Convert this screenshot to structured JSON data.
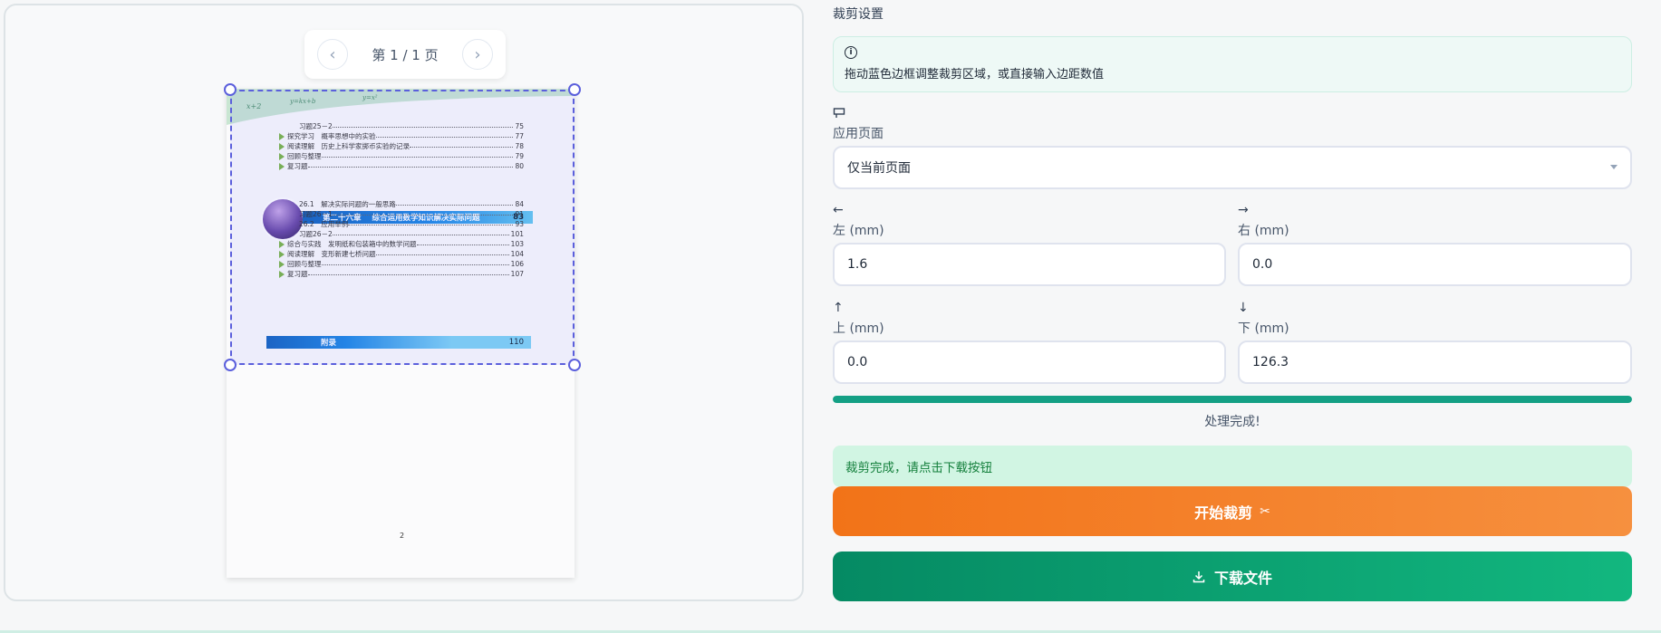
{
  "pager": {
    "prev_icon": "chevron-left-icon",
    "next_icon": "chevron-right-icon",
    "label": "第 1 / 1 页"
  },
  "preview": {
    "toc": {
      "lines": [
        {
          "text": "习题25－2",
          "page": "75",
          "bullet": false,
          "indent": true
        },
        {
          "text": "探究学习　概率思想中的实验",
          "page": "77",
          "bullet": true,
          "indent": false
        },
        {
          "text": "阅读理解　历史上科学家掷币实验的记录",
          "page": "78",
          "bullet": true,
          "indent": false
        },
        {
          "text": "回顾与整理",
          "page": "79",
          "bullet": true,
          "indent": false
        },
        {
          "text": "复习题",
          "page": "80",
          "bullet": true,
          "indent": false
        }
      ],
      "chapter": {
        "label": "第二十六章",
        "title": "综合运用数学知识解决实际问题",
        "page": "83"
      },
      "lines2": [
        {
          "text": "26.1　解决实际问题的一般思路",
          "page": "84",
          "bullet": false,
          "indent": true
        },
        {
          "text": "习题26－1",
          "page": "91",
          "bullet": false,
          "indent": true
        },
        {
          "text": "26.2　应用举例",
          "page": "93",
          "bullet": false,
          "indent": true
        },
        {
          "text": "习题26－2",
          "page": "101",
          "bullet": false,
          "indent": true
        },
        {
          "text": "综合与实践　发明纸和包装箱中的数学问题",
          "page": "103",
          "bullet": true,
          "indent": false
        },
        {
          "text": "阅读理解　变形新建七桥问题",
          "page": "104",
          "bullet": true,
          "indent": false
        },
        {
          "text": "回顾与整理",
          "page": "106",
          "bullet": true,
          "indent": false
        },
        {
          "text": "复习题",
          "page": "107",
          "bullet": true,
          "indent": false
        }
      ],
      "appendix": {
        "label": "附录",
        "page": "110"
      }
    },
    "page_number": "2"
  },
  "settings": {
    "title": "裁剪设置",
    "info_icon": "info-icon",
    "info_text": "拖动蓝色边框调整裁剪区域，或直接输入边距数值",
    "apply_pages": {
      "icon": "page-icon",
      "label": "应用页面",
      "value": "仅当前页面"
    },
    "left": {
      "icon": "arrow-left-icon",
      "label": "左 (mm)",
      "value": "1.6"
    },
    "right": {
      "icon": "arrow-right-icon",
      "label": "右 (mm)",
      "value": "0.0"
    },
    "top": {
      "icon": "arrow-up-icon",
      "label": "上 (mm)",
      "value": "0.0"
    },
    "bottom": {
      "icon": "arrow-down-icon",
      "label": "下 (mm)",
      "value": "126.3"
    },
    "progress": {
      "percent": 100,
      "text": "处理完成!"
    },
    "success_text": "裁剪完成，请点击下载按钮",
    "start_button": "开始裁剪",
    "download_button": "下载文件"
  }
}
